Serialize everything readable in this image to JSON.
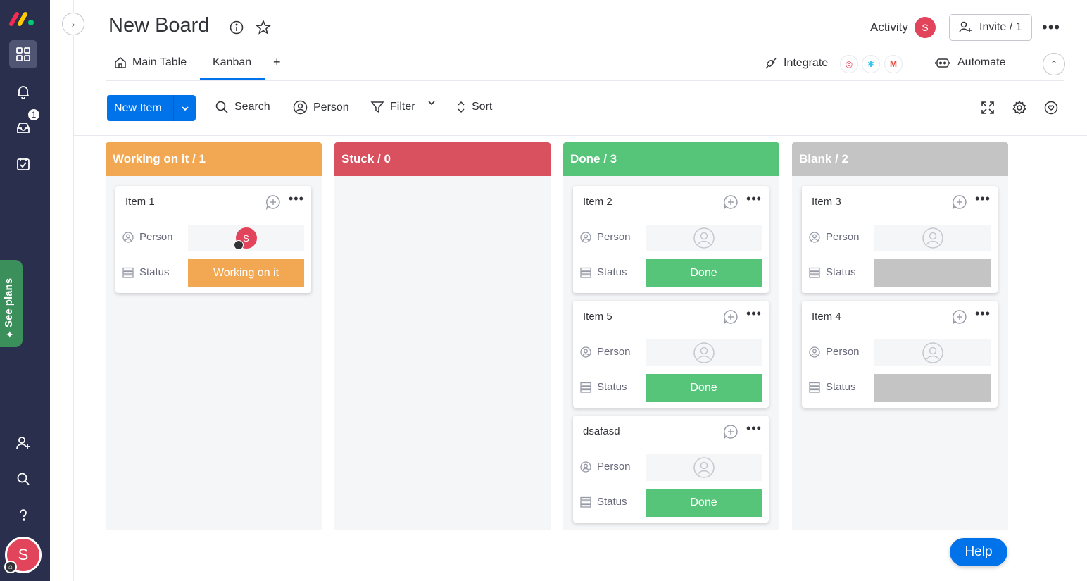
{
  "rail": {
    "notification_count": "1",
    "see_plans_label": "See plans",
    "user_initial": "S"
  },
  "header": {
    "board_title": "New Board",
    "activity_label": "Activity",
    "activity_avatar_initial": "S",
    "invite_label": "Invite / 1"
  },
  "views": {
    "tabs": [
      {
        "label": "Main Table"
      },
      {
        "label": "Kanban"
      }
    ],
    "add_label": "+",
    "integrate_label": "Integrate",
    "automate_label": "Automate"
  },
  "toolbar": {
    "new_item_label": "New Item",
    "search_label": "Search",
    "person_label": "Person",
    "filter_label": "Filter",
    "sort_label": "Sort"
  },
  "colors": {
    "working": "#f2a853",
    "stuck": "#d9505f",
    "done": "#56c57a",
    "blank": "#c4c4c4",
    "accent": "#0073ea"
  },
  "columns": [
    {
      "title": "Working on it / 1",
      "cards": [
        {
          "title": "Item 1",
          "person_label": "Person",
          "status_label": "Status",
          "status_value": "Working on it",
          "assignee_initial": "S"
        }
      ]
    },
    {
      "title": "Stuck / 0",
      "cards": []
    },
    {
      "title": "Done / 3",
      "cards": [
        {
          "title": "Item 2",
          "person_label": "Person",
          "status_label": "Status",
          "status_value": "Done"
        },
        {
          "title": "Item 5",
          "person_label": "Person",
          "status_label": "Status",
          "status_value": "Done"
        },
        {
          "title": "dsafasd",
          "person_label": "Person",
          "status_label": "Status",
          "status_value": "Done"
        }
      ]
    },
    {
      "title": "Blank / 2",
      "cards": [
        {
          "title": "Item 3",
          "person_label": "Person",
          "status_label": "Status",
          "status_value": ""
        },
        {
          "title": "Item 4",
          "person_label": "Person",
          "status_label": "Status",
          "status_value": ""
        }
      ]
    }
  ],
  "help_label": "Help"
}
